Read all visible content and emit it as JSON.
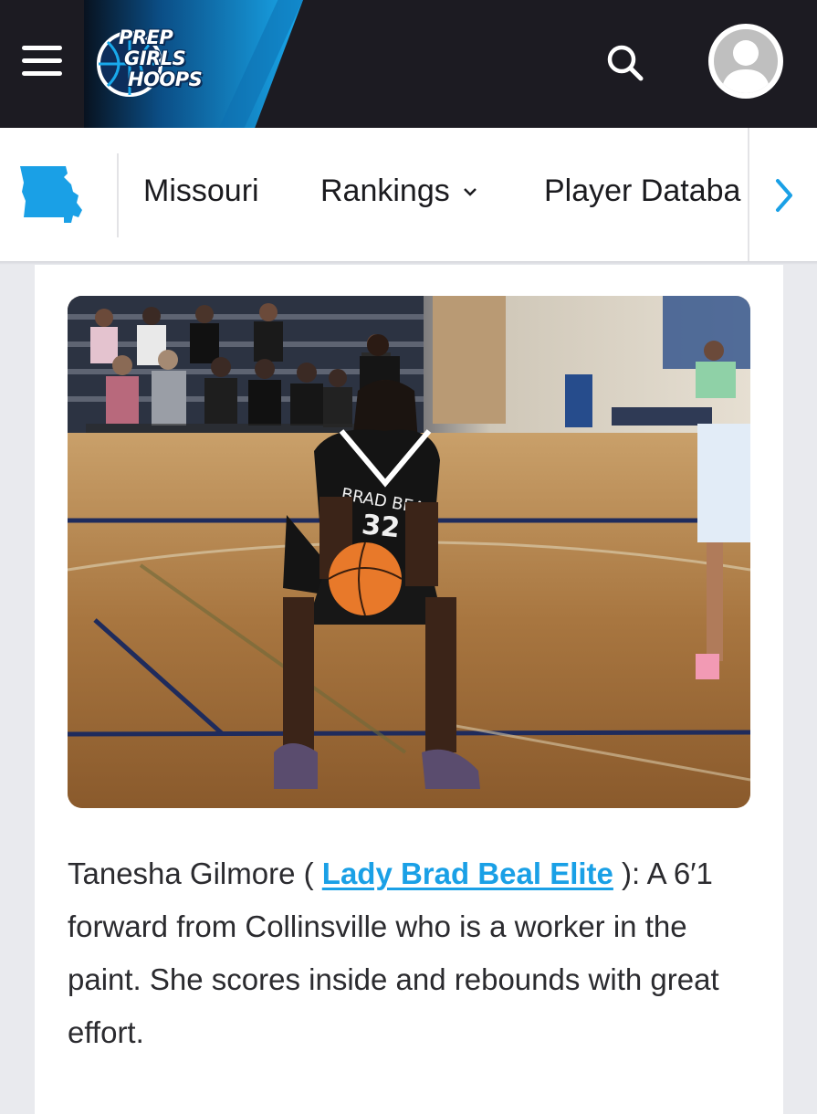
{
  "header": {
    "logo_lines": [
      "PREP",
      "GIRLS",
      "HOOPS"
    ],
    "menu_icon": "hamburger-menu-icon",
    "search_icon": "search-icon",
    "avatar_icon": "user-avatar-icon",
    "colors": {
      "bar": "#1c1b22",
      "accent": "#19a9ec"
    }
  },
  "subnav": {
    "state_icon": "missouri-state-icon",
    "items": [
      {
        "label": "Missouri"
      },
      {
        "label": "Rankings",
        "has_dropdown": true
      },
      {
        "label": "Player Databa"
      }
    ],
    "next_icon": "chevron-right-icon",
    "colors": {
      "accent": "#1aa0e6"
    }
  },
  "article": {
    "photo_subject": "basketball-free-throw-photo",
    "jersey_text": "BRAD BEAL",
    "jersey_number": "32",
    "caption": {
      "before": "Tanesha Gilmore ( ",
      "link": "Lady Brad Beal Elite",
      "after": " ): A 6′1 forward from Collinsville who is a worker in the paint. She scores inside and rebounds with great effort."
    }
  }
}
